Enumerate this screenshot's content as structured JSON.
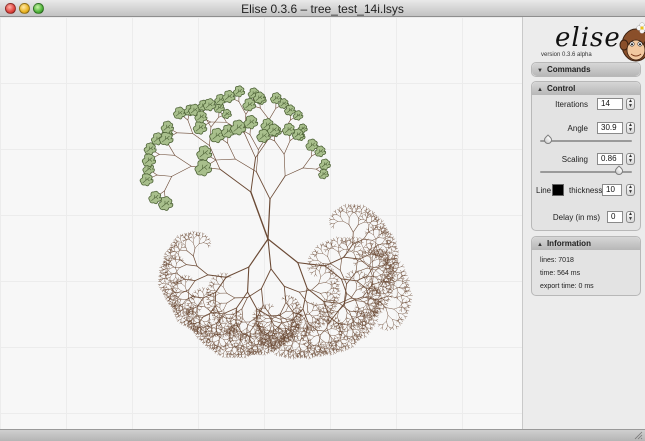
{
  "window": {
    "title": "Elise 0.3.6 – tree_test_14i.lsys"
  },
  "logo": {
    "word": "elise",
    "version": "version 0.3.6 alpha"
  },
  "icons": {
    "close": "close-button-icon",
    "minimize": "minimize-button-icon",
    "zoom": "zoom-button-icon",
    "mascot": "monkey-mascot-icon",
    "collapse": "triangle-down-icon",
    "expand": "triangle-up-icon",
    "resize": "resize-grip-icon"
  },
  "commands": {
    "label": "Commands"
  },
  "control": {
    "label": "Control",
    "iterations_label": "Iterations",
    "iterations_value": "14",
    "angle_label": "Angle",
    "angle_value": "30.9",
    "angle_slider_fraction": 0.09,
    "scaling_label": "Scaling",
    "scaling_value": "0.86",
    "scaling_slider_fraction": 0.86,
    "line_label": "Line",
    "line_color": "#000000",
    "thickness_label": "thickness",
    "thickness_value": "10",
    "delay_label": "Delay (in ms)",
    "delay_value": "0"
  },
  "information": {
    "label": "Information",
    "lines": "lines: 7018",
    "time": "time: 564 ms",
    "export_time": "export time: 0 ms"
  },
  "colors": {
    "leaf_fill": "#a8bf8c",
    "leaf_stroke": "#4f6438",
    "branch": "#6b4a35"
  }
}
